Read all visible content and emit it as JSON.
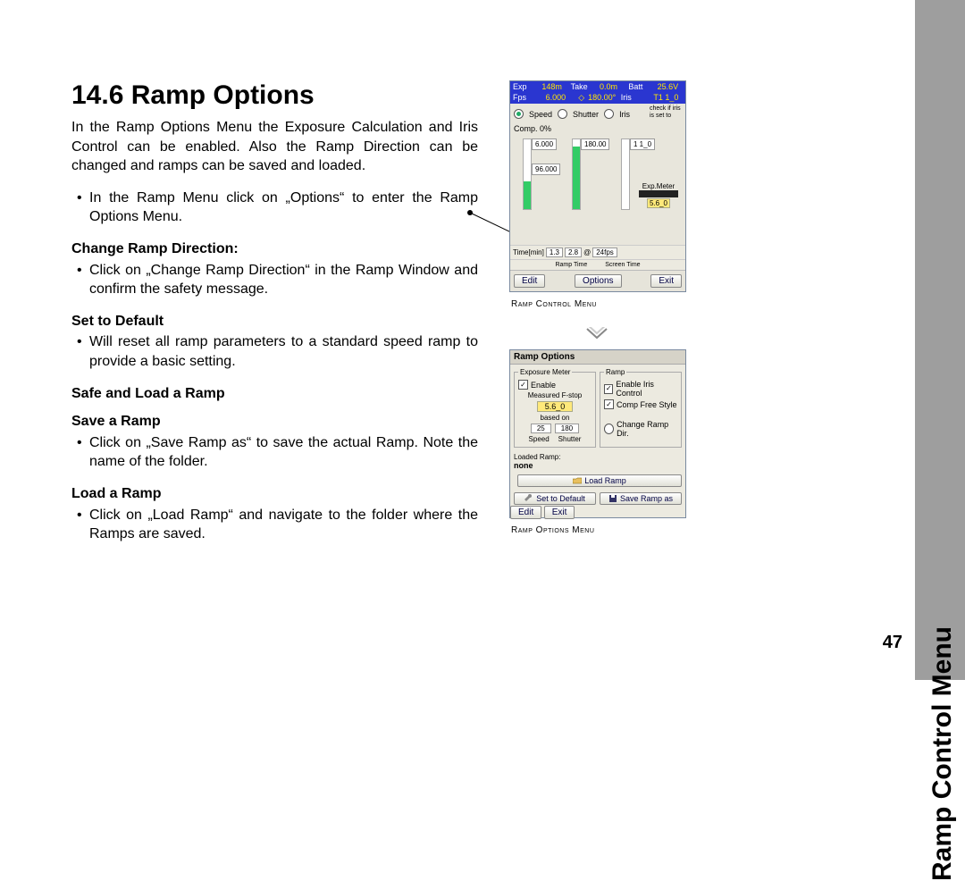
{
  "sidebar_title": "Ramp Control Menu",
  "page_number": "47",
  "heading": "14.6 Ramp Options",
  "intro": "In the Ramp Options Menu the Exposure Calculation and Iris Control can be enabled. Also the Ramp Direction can be changed and ramps can be saved and loaded.",
  "bullet1": "In the Ramp Menu click on „Options“ to enter the Ramp Options Menu.",
  "h_change": "Change Ramp Direction:",
  "bullet_change": "Click on „Change Ramp Direction“ in the Ramp Window and confirm the safety message.",
  "h_default": "Set to Default",
  "bullet_default": "Will reset all ramp parameters to a standard speed ramp to provide a basic setting.",
  "h_safeload": "Safe and Load a Ramp",
  "h_save": "Save a Ramp",
  "bullet_save": "Click on „Save Ramp as“ to save the actual Ramp. Note the name of the folder.",
  "h_load": "Load a Ramp",
  "bullet_load": "Click on „Load Ramp“ and navigate to the folder where the Ramps are saved.",
  "caption1": "Ramp Control Menu",
  "caption2": "Ramp Options Menu",
  "rcm": {
    "row1": {
      "exp": "Exp",
      "exp_v": "148m",
      "take": "Take",
      "take_v": "0.0m",
      "batt": "Batt",
      "batt_v": "25.6V"
    },
    "row2": {
      "fps": "Fps",
      "fps_v": "6.000",
      "shutter": "180.00°",
      "iris": "Iris",
      "t": "T1 1_0"
    },
    "speed": "Speed",
    "shutter_lbl": "Shutter",
    "iris_lbl": "Iris",
    "iris_note": "check if iris is set to",
    "comp": "Comp.",
    "comp_v": "0%",
    "v1": "6.000",
    "v2": "180.00",
    "v3": "1 1_0",
    "v4": "96.000",
    "expmeter": "Exp.Meter",
    "expmeter_v": "5.6_0",
    "time_lbl": "Time[min]",
    "time_v": "1.3",
    "screen_v": "2.8",
    "at": "@",
    "fps24": "24fps",
    "sub1": "Ramp Time",
    "sub2": "Screen Time",
    "edit": "Edit",
    "options": "Options",
    "exit": "Exit"
  },
  "rom": {
    "title": "Ramp Options",
    "grp1": "Exposure Meter",
    "grp2": "Ramp",
    "enable": "Enable",
    "enable_iris": "Enable Iris Control",
    "comp_free": "Comp Free Style",
    "measured": "Measured F-stop",
    "fstop": "5.6_0",
    "based": "based on",
    "speed": "Speed",
    "shutter": "Shutter",
    "speed_v": "25",
    "shutter_v": "180",
    "change_dir": "Change Ramp Dir.",
    "loaded": "Loaded Ramp:",
    "loaded_v": "none",
    "load": "Load Ramp",
    "default": "Set to Default",
    "save": "Save Ramp as",
    "edit": "Edit",
    "exit": "Exit"
  }
}
